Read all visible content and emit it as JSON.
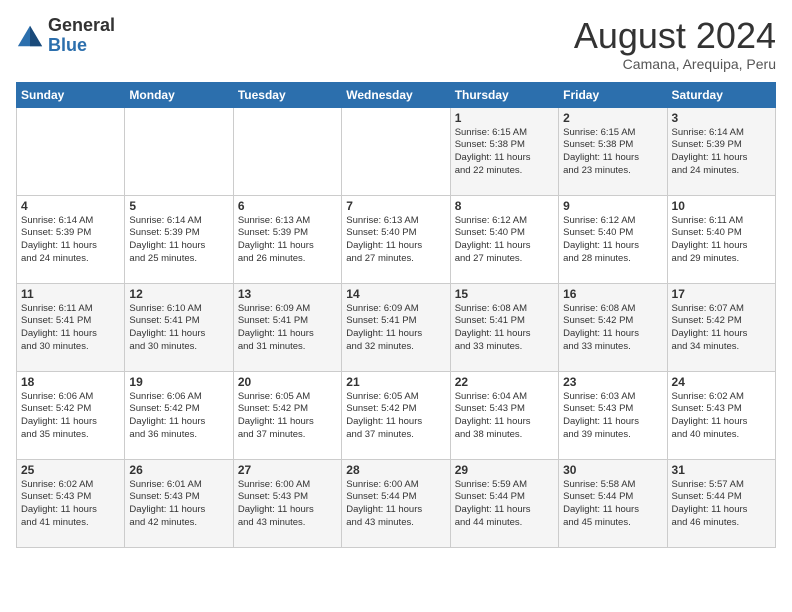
{
  "header": {
    "logo_general": "General",
    "logo_blue": "Blue",
    "month_title": "August 2024",
    "location": "Camana, Arequipa, Peru"
  },
  "days_of_week": [
    "Sunday",
    "Monday",
    "Tuesday",
    "Wednesday",
    "Thursday",
    "Friday",
    "Saturday"
  ],
  "weeks": [
    [
      {
        "day": "",
        "info": ""
      },
      {
        "day": "",
        "info": ""
      },
      {
        "day": "",
        "info": ""
      },
      {
        "day": "",
        "info": ""
      },
      {
        "day": "1",
        "info": "Sunrise: 6:15 AM\nSunset: 5:38 PM\nDaylight: 11 hours\nand 22 minutes."
      },
      {
        "day": "2",
        "info": "Sunrise: 6:15 AM\nSunset: 5:38 PM\nDaylight: 11 hours\nand 23 minutes."
      },
      {
        "day": "3",
        "info": "Sunrise: 6:14 AM\nSunset: 5:39 PM\nDaylight: 11 hours\nand 24 minutes."
      }
    ],
    [
      {
        "day": "4",
        "info": "Sunrise: 6:14 AM\nSunset: 5:39 PM\nDaylight: 11 hours\nand 24 minutes."
      },
      {
        "day": "5",
        "info": "Sunrise: 6:14 AM\nSunset: 5:39 PM\nDaylight: 11 hours\nand 25 minutes."
      },
      {
        "day": "6",
        "info": "Sunrise: 6:13 AM\nSunset: 5:39 PM\nDaylight: 11 hours\nand 26 minutes."
      },
      {
        "day": "7",
        "info": "Sunrise: 6:13 AM\nSunset: 5:40 PM\nDaylight: 11 hours\nand 27 minutes."
      },
      {
        "day": "8",
        "info": "Sunrise: 6:12 AM\nSunset: 5:40 PM\nDaylight: 11 hours\nand 27 minutes."
      },
      {
        "day": "9",
        "info": "Sunrise: 6:12 AM\nSunset: 5:40 PM\nDaylight: 11 hours\nand 28 minutes."
      },
      {
        "day": "10",
        "info": "Sunrise: 6:11 AM\nSunset: 5:40 PM\nDaylight: 11 hours\nand 29 minutes."
      }
    ],
    [
      {
        "day": "11",
        "info": "Sunrise: 6:11 AM\nSunset: 5:41 PM\nDaylight: 11 hours\nand 30 minutes."
      },
      {
        "day": "12",
        "info": "Sunrise: 6:10 AM\nSunset: 5:41 PM\nDaylight: 11 hours\nand 30 minutes."
      },
      {
        "day": "13",
        "info": "Sunrise: 6:09 AM\nSunset: 5:41 PM\nDaylight: 11 hours\nand 31 minutes."
      },
      {
        "day": "14",
        "info": "Sunrise: 6:09 AM\nSunset: 5:41 PM\nDaylight: 11 hours\nand 32 minutes."
      },
      {
        "day": "15",
        "info": "Sunrise: 6:08 AM\nSunset: 5:41 PM\nDaylight: 11 hours\nand 33 minutes."
      },
      {
        "day": "16",
        "info": "Sunrise: 6:08 AM\nSunset: 5:42 PM\nDaylight: 11 hours\nand 33 minutes."
      },
      {
        "day": "17",
        "info": "Sunrise: 6:07 AM\nSunset: 5:42 PM\nDaylight: 11 hours\nand 34 minutes."
      }
    ],
    [
      {
        "day": "18",
        "info": "Sunrise: 6:06 AM\nSunset: 5:42 PM\nDaylight: 11 hours\nand 35 minutes."
      },
      {
        "day": "19",
        "info": "Sunrise: 6:06 AM\nSunset: 5:42 PM\nDaylight: 11 hours\nand 36 minutes."
      },
      {
        "day": "20",
        "info": "Sunrise: 6:05 AM\nSunset: 5:42 PM\nDaylight: 11 hours\nand 37 minutes."
      },
      {
        "day": "21",
        "info": "Sunrise: 6:05 AM\nSunset: 5:42 PM\nDaylight: 11 hours\nand 37 minutes."
      },
      {
        "day": "22",
        "info": "Sunrise: 6:04 AM\nSunset: 5:43 PM\nDaylight: 11 hours\nand 38 minutes."
      },
      {
        "day": "23",
        "info": "Sunrise: 6:03 AM\nSunset: 5:43 PM\nDaylight: 11 hours\nand 39 minutes."
      },
      {
        "day": "24",
        "info": "Sunrise: 6:02 AM\nSunset: 5:43 PM\nDaylight: 11 hours\nand 40 minutes."
      }
    ],
    [
      {
        "day": "25",
        "info": "Sunrise: 6:02 AM\nSunset: 5:43 PM\nDaylight: 11 hours\nand 41 minutes."
      },
      {
        "day": "26",
        "info": "Sunrise: 6:01 AM\nSunset: 5:43 PM\nDaylight: 11 hours\nand 42 minutes."
      },
      {
        "day": "27",
        "info": "Sunrise: 6:00 AM\nSunset: 5:43 PM\nDaylight: 11 hours\nand 43 minutes."
      },
      {
        "day": "28",
        "info": "Sunrise: 6:00 AM\nSunset: 5:44 PM\nDaylight: 11 hours\nand 43 minutes."
      },
      {
        "day": "29",
        "info": "Sunrise: 5:59 AM\nSunset: 5:44 PM\nDaylight: 11 hours\nand 44 minutes."
      },
      {
        "day": "30",
        "info": "Sunrise: 5:58 AM\nSunset: 5:44 PM\nDaylight: 11 hours\nand 45 minutes."
      },
      {
        "day": "31",
        "info": "Sunrise: 5:57 AM\nSunset: 5:44 PM\nDaylight: 11 hours\nand 46 minutes."
      }
    ]
  ]
}
